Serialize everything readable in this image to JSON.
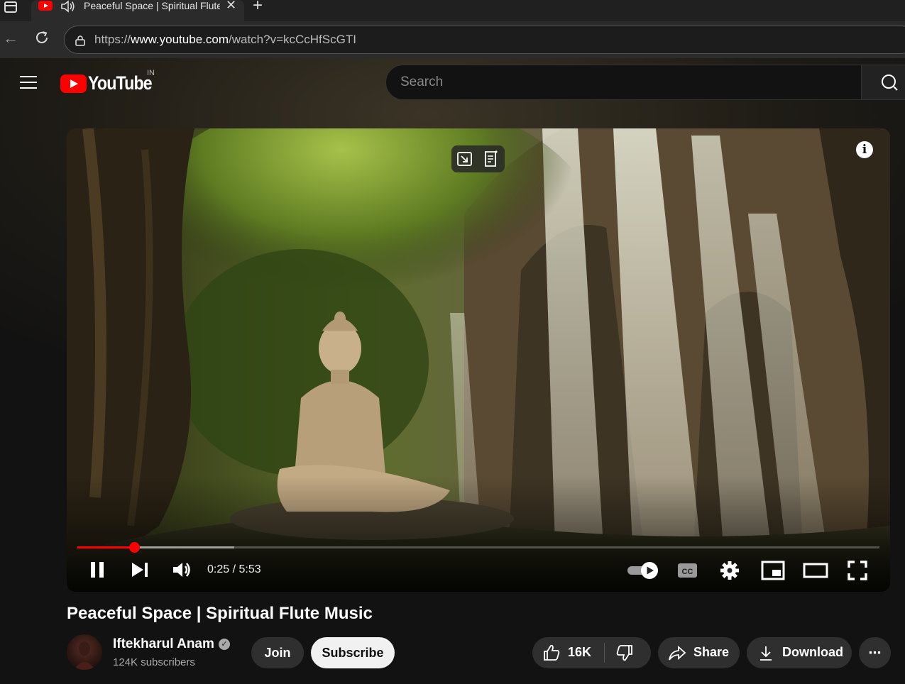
{
  "browser": {
    "tab_title": "Peaceful Space | Spiritual Flute Music - YouTube",
    "new_tab_label": "+",
    "close_label": "✕",
    "url_prefix": "https://",
    "url_host": "www.youtube.com",
    "url_path": "/watch?v=kcCcHfScGTI"
  },
  "header": {
    "logo_text": "YouTube",
    "country_code": "IN",
    "search_placeholder": "Search"
  },
  "player": {
    "current_time": "0:25",
    "duration": "5:53",
    "time_display": "0:25 / 5:53",
    "played_fraction": 0.071,
    "buffered_fraction": 0.196,
    "info_label": "i",
    "cc_label": "CC",
    "autoplay_on": true
  },
  "video": {
    "title": "Peaceful Space | Spiritual Flute Music",
    "channel_name": "Iftekharul Anam",
    "subscribers": "124K subscribers",
    "join_label": "Join",
    "subscribe_label": "Subscribe",
    "likes": "16K",
    "share_label": "Share",
    "download_label": "Download",
    "more_label": "⋯"
  },
  "icons": [
    "window-icon",
    "youtube-favicon",
    "speaker-icon",
    "close-icon",
    "plus-icon",
    "back-icon",
    "reload-icon",
    "lock-icon",
    "menu-icon",
    "search-icon",
    "miniplayer-switch-icon",
    "notes-icon",
    "info-icon",
    "pause-icon",
    "next-icon",
    "volume-icon",
    "autoplay-toggle-icon",
    "captions-icon",
    "settings-icon",
    "miniplayer-icon",
    "theater-icon",
    "fullscreen-icon",
    "verified-icon",
    "like-icon",
    "dislike-icon",
    "share-icon",
    "download-icon",
    "more-icon"
  ],
  "colors": {
    "brand_red": "#ff0000",
    "page_bg": "#0f0f0f",
    "button_bg": "#2f2f2f",
    "subscribe_bg": "#f1f1f1"
  }
}
